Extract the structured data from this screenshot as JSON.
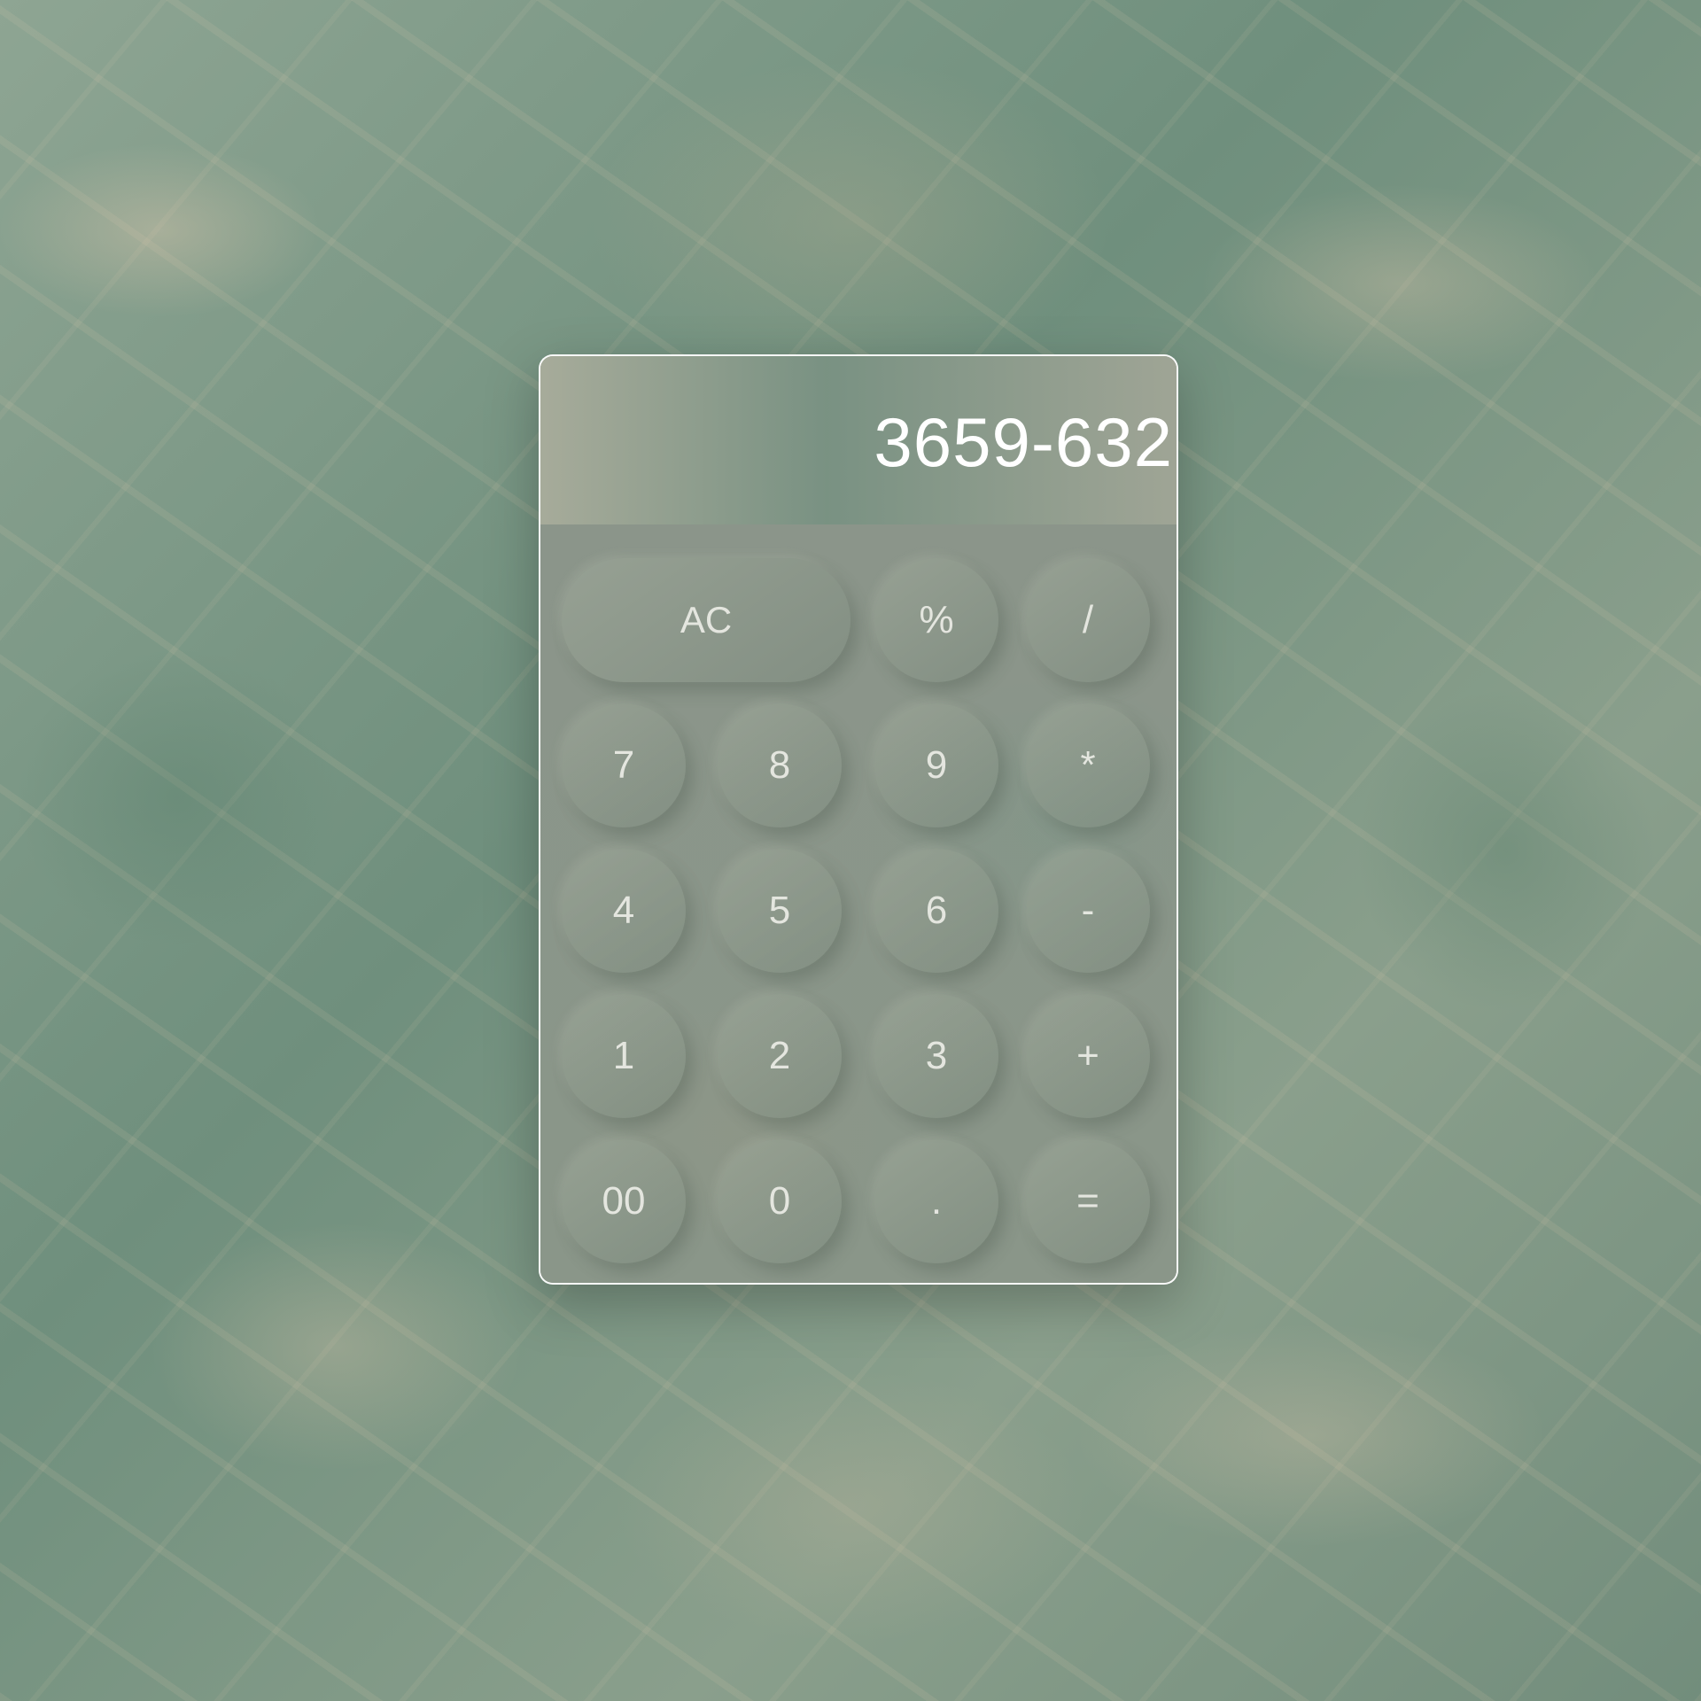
{
  "display": {
    "value": "3659-632"
  },
  "keys": {
    "clear": "AC",
    "percent": "%",
    "divide": "/",
    "seven": "7",
    "eight": "8",
    "nine": "9",
    "multiply": "*",
    "four": "4",
    "five": "5",
    "six": "6",
    "subtract": "-",
    "one": "1",
    "two": "2",
    "three": "3",
    "add": "+",
    "double_zero": "00",
    "zero": "0",
    "decimal": ".",
    "equals": "="
  }
}
